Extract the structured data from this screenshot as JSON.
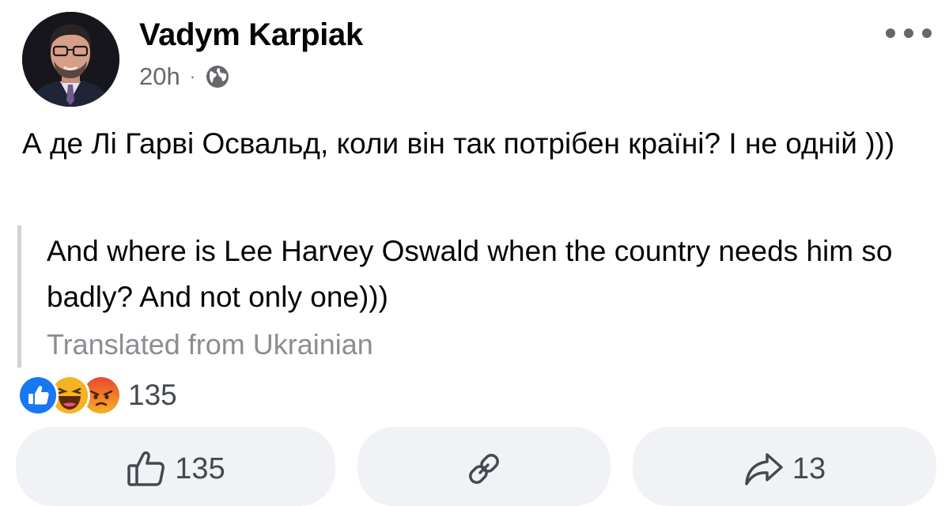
{
  "post": {
    "author": "Vadym Karpiak",
    "time": "20h",
    "separator": "·",
    "original_text": "А де Лі Гарві Освальд, коли він так потрібен країні? І не одній )))",
    "translated_text": "And where is Lee Harvey Oswald when the country needs him so badly? And not only one)))",
    "translation_note": "Translated from Ukrainian"
  },
  "reactions": {
    "types": [
      "like",
      "haha",
      "angry"
    ],
    "count": "135"
  },
  "actions": {
    "like_count": "135",
    "share_count": "13"
  },
  "icons": {
    "audience": "globe-icon",
    "menu": "more-options-icon",
    "like": "thumbs-up-icon",
    "copy": "link-icon",
    "share": "share-arrow-icon"
  },
  "colors": {
    "like_blue": "#1877f2",
    "haha_yellow": "#f7b125",
    "angry_red": "#e9710f",
    "secondary_text": "#65676b",
    "action_bg": "#f0f2f5"
  }
}
